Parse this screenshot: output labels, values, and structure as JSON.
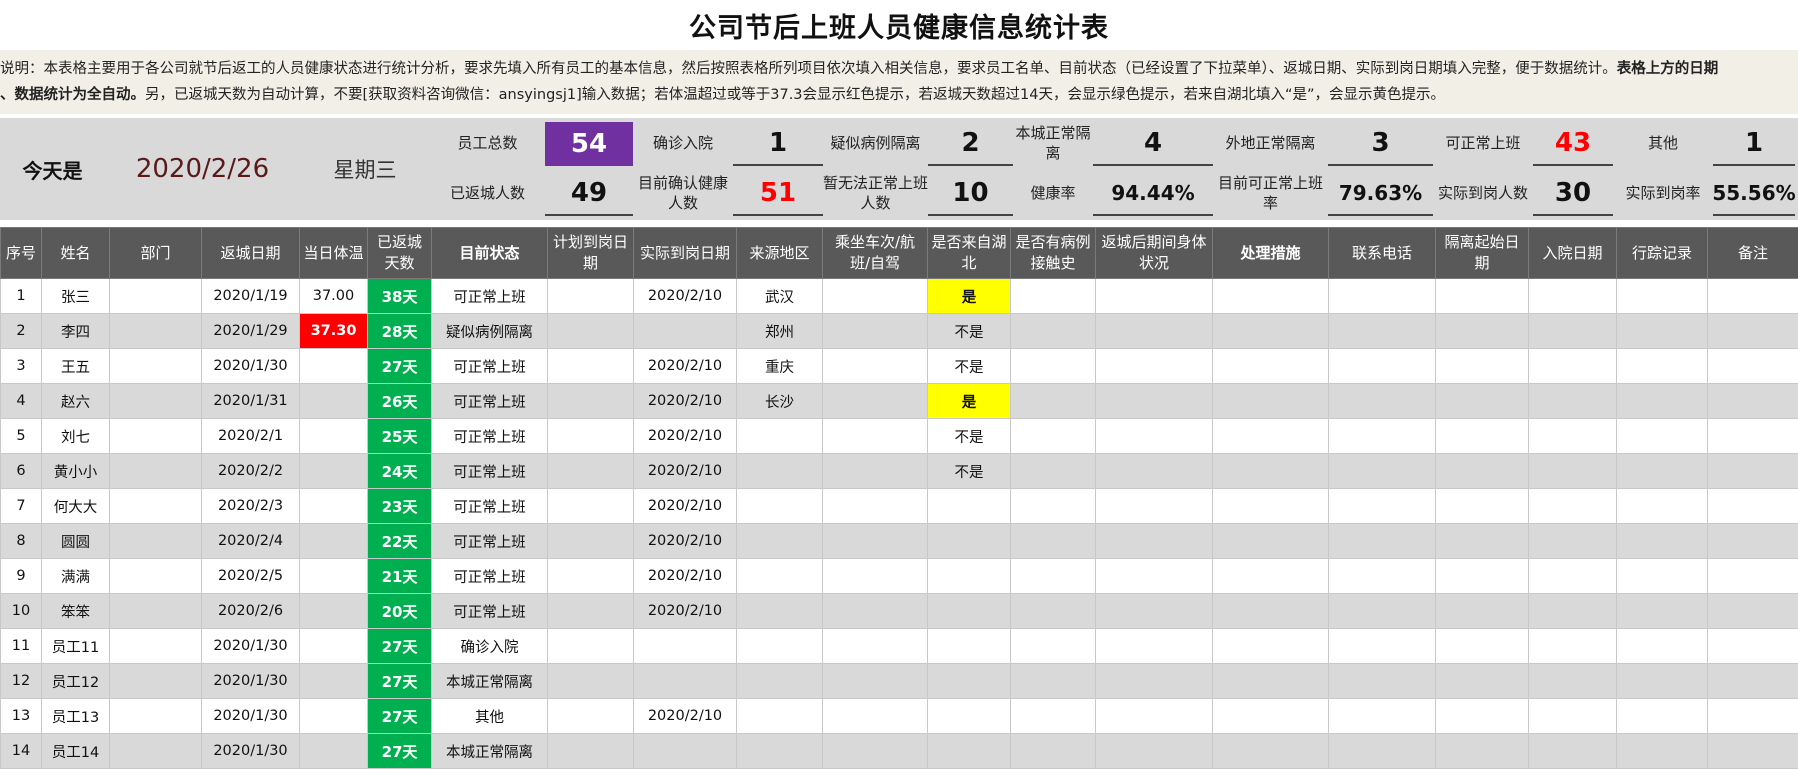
{
  "title": "公司节后上班人员健康信息统计表",
  "description": {
    "line1_a": "说明：本表格主要用于各公司就节后返工的人员健康状态进行统计分析，要求先填入所有员工的基本信息，然后按照表格所列项目依次填入相关信息，要求员工名单、目前状态（已经设置了下拉菜单）、返城日期、实际到岗日期填入完整，便于数据统计。",
    "line1_b": "表格上方的日期",
    "line2_a": "、数据统计为全自动。",
    "line2_b": "另，已返城天数为自动计算，不要[获取资料咨询微信：ansyingsj1]输入数据；若体温超过或等于37.3会显示红色提示，若返城天数超过14天，会显示绿色提示，若来自湖北填入“是”，会显示黄色提示。"
  },
  "summary": {
    "today_label": "今天是",
    "date": "2020/2/26",
    "weekday": "星期三",
    "total_staff_label": "员工总数",
    "total_staff": "54",
    "returned_label": "已返城人数",
    "returned": "49",
    "confirmed_label": "确诊入院",
    "confirmed": "1",
    "healthy_now_label": "目前确认健康人数",
    "healthy_now": "51",
    "suspected_label": "疑似病例隔离",
    "suspected": "2",
    "cannot_work_label": "暂无法正常上班人数",
    "cannot_work": "10",
    "local_iso_label": "本城正常隔离",
    "local_iso": "4",
    "health_rate_label": "健康率",
    "health_rate": "94.44%",
    "outside_iso_label": "外地正常隔离",
    "outside_iso": "3",
    "work_rate_label": "目前可正常上班率",
    "work_rate": "79.63%",
    "can_work_label": "可正常上班",
    "can_work": "43",
    "actual_label": "实际到岗人数",
    "actual": "30",
    "other_label": "其他",
    "other": "1",
    "actual_rate_label": "实际到岗率",
    "actual_rate": "55.56%"
  },
  "columns": [
    "序号",
    "姓名",
    "部门",
    "返城日期",
    "当日体温",
    "已返城天数",
    "目前状态",
    "计划到岗日期",
    "实际到岗日期",
    "来源地区",
    "乘坐车次/航班/自驾",
    "是否来自湖北",
    "是否有病例接触史",
    "返城后期间身体状况",
    "处理措施",
    "联系电话",
    "隔离起始日期",
    "入院日期",
    "行踪记录",
    "备注"
  ],
  "rows": [
    {
      "no": "1",
      "name": "张三",
      "dept": "",
      "return_date": "2020/1/19",
      "temp": "37.00",
      "days": "38天",
      "status": "可正常上班",
      "plan": "",
      "actual": "2020/2/10",
      "region": "武汉",
      "transport": "",
      "hubei": "是",
      "contact": "",
      "condition": "",
      "measure": "",
      "phone": "",
      "iso_start": "",
      "hosp": "",
      "track": "",
      "note": ""
    },
    {
      "no": "2",
      "name": "李四",
      "dept": "",
      "return_date": "2020/1/29",
      "temp": "37.30",
      "days": "28天",
      "status": "疑似病例隔离",
      "plan": "",
      "actual": "",
      "region": "郑州",
      "transport": "",
      "hubei": "不是",
      "contact": "",
      "condition": "",
      "measure": "",
      "phone": "",
      "iso_start": "",
      "hosp": "",
      "track": "",
      "note": ""
    },
    {
      "no": "3",
      "name": "王五",
      "dept": "",
      "return_date": "2020/1/30",
      "temp": "",
      "days": "27天",
      "status": "可正常上班",
      "plan": "",
      "actual": "2020/2/10",
      "region": "重庆",
      "transport": "",
      "hubei": "不是",
      "contact": "",
      "condition": "",
      "measure": "",
      "phone": "",
      "iso_start": "",
      "hosp": "",
      "track": "",
      "note": ""
    },
    {
      "no": "4",
      "name": "赵六",
      "dept": "",
      "return_date": "2020/1/31",
      "temp": "",
      "days": "26天",
      "status": "可正常上班",
      "plan": "",
      "actual": "2020/2/10",
      "region": "长沙",
      "transport": "",
      "hubei": "是",
      "contact": "",
      "condition": "",
      "measure": "",
      "phone": "",
      "iso_start": "",
      "hosp": "",
      "track": "",
      "note": ""
    },
    {
      "no": "5",
      "name": "刘七",
      "dept": "",
      "return_date": "2020/2/1",
      "temp": "",
      "days": "25天",
      "status": "可正常上班",
      "plan": "",
      "actual": "2020/2/10",
      "region": "",
      "transport": "",
      "hubei": "不是",
      "contact": "",
      "condition": "",
      "measure": "",
      "phone": "",
      "iso_start": "",
      "hosp": "",
      "track": "",
      "note": ""
    },
    {
      "no": "6",
      "name": "黄小小",
      "dept": "",
      "return_date": "2020/2/2",
      "temp": "",
      "days": "24天",
      "status": "可正常上班",
      "plan": "",
      "actual": "2020/2/10",
      "region": "",
      "transport": "",
      "hubei": "不是",
      "contact": "",
      "condition": "",
      "measure": "",
      "phone": "",
      "iso_start": "",
      "hosp": "",
      "track": "",
      "note": ""
    },
    {
      "no": "7",
      "name": "何大大",
      "dept": "",
      "return_date": "2020/2/3",
      "temp": "",
      "days": "23天",
      "status": "可正常上班",
      "plan": "",
      "actual": "2020/2/10",
      "region": "",
      "transport": "",
      "hubei": "",
      "contact": "",
      "condition": "",
      "measure": "",
      "phone": "",
      "iso_start": "",
      "hosp": "",
      "track": "",
      "note": ""
    },
    {
      "no": "8",
      "name": "圆圆",
      "dept": "",
      "return_date": "2020/2/4",
      "temp": "",
      "days": "22天",
      "status": "可正常上班",
      "plan": "",
      "actual": "2020/2/10",
      "region": "",
      "transport": "",
      "hubei": "",
      "contact": "",
      "condition": "",
      "measure": "",
      "phone": "",
      "iso_start": "",
      "hosp": "",
      "track": "",
      "note": ""
    },
    {
      "no": "9",
      "name": "满满",
      "dept": "",
      "return_date": "2020/2/5",
      "temp": "",
      "days": "21天",
      "status": "可正常上班",
      "plan": "",
      "actual": "2020/2/10",
      "region": "",
      "transport": "",
      "hubei": "",
      "contact": "",
      "condition": "",
      "measure": "",
      "phone": "",
      "iso_start": "",
      "hosp": "",
      "track": "",
      "note": ""
    },
    {
      "no": "10",
      "name": "笨笨",
      "dept": "",
      "return_date": "2020/2/6",
      "temp": "",
      "days": "20天",
      "status": "可正常上班",
      "plan": "",
      "actual": "2020/2/10",
      "region": "",
      "transport": "",
      "hubei": "",
      "contact": "",
      "condition": "",
      "measure": "",
      "phone": "",
      "iso_start": "",
      "hosp": "",
      "track": "",
      "note": ""
    },
    {
      "no": "11",
      "name": "员工11",
      "dept": "",
      "return_date": "2020/1/30",
      "temp": "",
      "days": "27天",
      "status": "确诊入院",
      "plan": "",
      "actual": "",
      "region": "",
      "transport": "",
      "hubei": "",
      "contact": "",
      "condition": "",
      "measure": "",
      "phone": "",
      "iso_start": "",
      "hosp": "",
      "track": "",
      "note": ""
    },
    {
      "no": "12",
      "name": "员工12",
      "dept": "",
      "return_date": "2020/1/30",
      "temp": "",
      "days": "27天",
      "status": "本城正常隔离",
      "plan": "",
      "actual": "",
      "region": "",
      "transport": "",
      "hubei": "",
      "contact": "",
      "condition": "",
      "measure": "",
      "phone": "",
      "iso_start": "",
      "hosp": "",
      "track": "",
      "note": ""
    },
    {
      "no": "13",
      "name": "员工13",
      "dept": "",
      "return_date": "2020/1/30",
      "temp": "",
      "days": "27天",
      "status": "其他",
      "plan": "",
      "actual": "2020/2/10",
      "region": "",
      "transport": "",
      "hubei": "",
      "contact": "",
      "condition": "",
      "measure": "",
      "phone": "",
      "iso_start": "",
      "hosp": "",
      "track": "",
      "note": ""
    },
    {
      "no": "14",
      "name": "员工14",
      "dept": "",
      "return_date": "2020/1/30",
      "temp": "",
      "days": "27天",
      "status": "本城正常隔离",
      "plan": "",
      "actual": "",
      "region": "",
      "transport": "",
      "hubei": "",
      "contact": "",
      "condition": "",
      "measure": "",
      "phone": "",
      "iso_start": "",
      "hosp": "",
      "track": "",
      "note": ""
    }
  ],
  "colors": {
    "header_bg": "#595959",
    "stripe": "#d9d9d9",
    "days_green": "#00b050",
    "fever_red": "#ff0000",
    "hubei_yellow": "#ffff00",
    "total_purple": "#7030a0"
  }
}
